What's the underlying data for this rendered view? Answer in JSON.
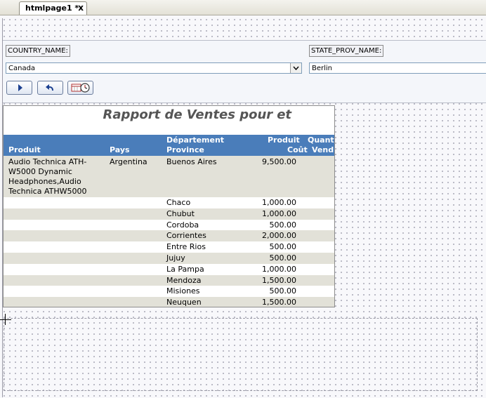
{
  "tab": {
    "title": "htmlpage1 *",
    "close": "x"
  },
  "params": {
    "country_label": "COUNTRY_NAME:",
    "country_value": "Canada",
    "state_label": "STATE_PROV_NAME:",
    "state_value": "Berlin"
  },
  "toolbar": {
    "run_icon": "play-icon",
    "back_icon": "undo-arrow-icon",
    "options_icon": "calendar-clock-icon"
  },
  "report": {
    "title_main": "Rapport de Ventes pour",
    "title_tail": "et",
    "headers": {
      "product": "Produit",
      "country": "Pays",
      "dept1": "Département",
      "dept2": "Province",
      "cost1": "Produit",
      "cost2": "Coût",
      "qty1": "Quanti",
      "qty2": "Vend"
    },
    "first_row": {
      "product": [
        "Audio Technica ATH-",
        "W5000 Dynamic",
        "Headphones,Audio",
        "Technica ATHW5000"
      ],
      "country": "Argentina",
      "province": "Buenos Aires",
      "cost": "9,500.00"
    },
    "rows": [
      {
        "province": "Chaco",
        "cost": "1,000.00"
      },
      {
        "province": "Chubut",
        "cost": "1,000.00"
      },
      {
        "province": "Cordoba",
        "cost": "500.00"
      },
      {
        "province": "Corrientes",
        "cost": "2,000.00"
      },
      {
        "province": "Entre Rios",
        "cost": "500.00"
      },
      {
        "province": "Jujuy",
        "cost": "500.00"
      },
      {
        "province": "La Pampa",
        "cost": "1,000.00"
      },
      {
        "province": "Mendoza",
        "cost": "1,500.00"
      },
      {
        "province": "Misiones",
        "cost": "500.00"
      },
      {
        "province": "Neuquen",
        "cost": "1,500.00"
      }
    ]
  },
  "colors": {
    "header_bg": "#4a7dba",
    "row_alt": "#e2e1d8",
    "row_plain": "#ffffff"
  }
}
